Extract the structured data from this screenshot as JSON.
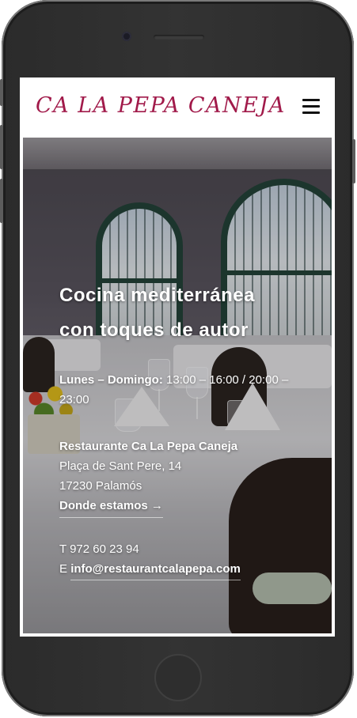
{
  "site": {
    "logo": "CA LA PEPA CANEJA",
    "menu_icon": "hamburger-menu-icon"
  },
  "hero": {
    "title_line1": "Cocina mediterránea",
    "title_line2": "con toques de autor",
    "hours_label": "Lunes – Domingo:",
    "hours_value": "13:00 – 16:00 / 20:00 – 23:00",
    "address_name": "Restaurante Ca La Pepa Caneja",
    "address_street": "Plaça de Sant Pere, 14",
    "address_city": "17230 Palamós",
    "map_link": "Donde estamos →",
    "phone_prefix": "T",
    "phone": "972 60 23 94",
    "email_prefix": "E",
    "email": "info@restaurantcalapepa.com"
  },
  "colors": {
    "brand": "#a11a4a",
    "text_on_hero": "#ffffff",
    "device_frame": "#2f2f2f"
  }
}
